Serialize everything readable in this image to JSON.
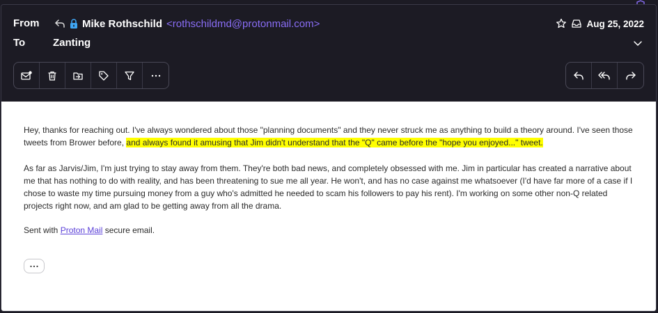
{
  "header": {
    "from_label": "From",
    "to_label": "To",
    "sender_name": "Mike Rothschild",
    "sender_email": "<rothschildmd@protonmail.com>",
    "recipient": "Zanting",
    "date": "Aug 25, 2022"
  },
  "toolbar_left": [
    "mark-unread-icon",
    "trash-icon",
    "move-to-folder-icon",
    "label-icon",
    "filter-icon",
    "more-icon"
  ],
  "toolbar_right": [
    "reply-icon",
    "reply-all-icon",
    "forward-icon"
  ],
  "message": {
    "p1_before": "Hey, thanks for reaching out. I've always wondered about those \"planning documents\" and they never struck me as anything to build a theory around. I've seen those tweets from Brower before, ",
    "p1_highlight": "and always found it amusing that Jim didn't understand that the \"Q\" came before the \"hope you enjoyed...\" tweet.",
    "p2": "As far as Jarvis/Jim, I'm just trying to stay away from them. They're both bad news, and completely obsessed with me. Jim in particular has created a narrative about me that has nothing to do with reality, and has been threatening to sue me all year. He won't, and has no case against me whatsoever (I'd have far more of a case if I chose to waste my time pursuing money from a guy who's admitted he needed to scam his followers to pay his rent). I'm working on some other non-Q related projects right now, and am glad to be getting away from all the drama.",
    "p3_before": "Sent with ",
    "p3_link": "Proton Mail",
    "p3_after": " secure email.",
    "more_label": "⋯"
  },
  "colors": {
    "header_bg": "#1c1b24",
    "accent": "#8a6ef7",
    "highlight": "#ffff00",
    "link": "#5a3fd8"
  }
}
